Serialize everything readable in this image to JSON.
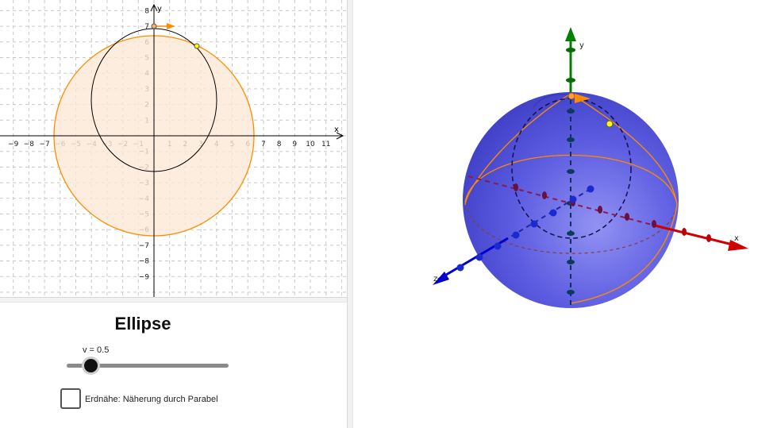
{
  "graphics2d": {
    "x_axis_label": "x",
    "y_axis_label": "y",
    "x_ticks": [
      -9,
      -8,
      -7,
      -6,
      -5,
      -4,
      -3,
      -2,
      -1,
      1,
      2,
      3,
      4,
      5,
      6,
      7,
      8,
      9,
      10,
      11
    ],
    "y_ticks": [
      -9,
      -8,
      -7,
      -6,
      -5,
      -4,
      -3,
      -2,
      -1,
      1,
      2,
      3,
      4,
      5,
      6,
      7,
      8
    ],
    "circle_color": "#ff8c00",
    "circle_fill": "#fbe9d7",
    "ellipse_color": "#000000",
    "point_color": "#ffff00"
  },
  "panel": {
    "title": "Ellipse",
    "slider_label": "v = 0.5",
    "slider_value": 0.15,
    "checkbox_label": "Erdnähe: Näherung durch Parabel",
    "checkbox_checked": false
  },
  "graphics3d": {
    "x_axis_label": "x",
    "y_axis_label": "y",
    "z_axis_label": "z",
    "sphere_color": "#4040d8",
    "x_axis_color": "#d00000",
    "y_axis_color": "#008000",
    "z_axis_color": "#0000cc"
  }
}
